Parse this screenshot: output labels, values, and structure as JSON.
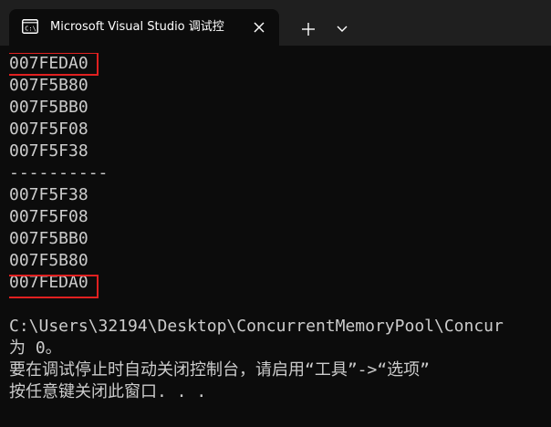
{
  "tab": {
    "title": "Microsoft Visual Studio 调试控",
    "icon": "console-icon",
    "close_icon": "close-icon"
  },
  "toolbar": {
    "new_tab_icon": "plus-icon",
    "dropdown_icon": "chevron-down-icon"
  },
  "console": {
    "lines": [
      "007FEDA0",
      "007F5B80",
      "007F5BB0",
      "007F5F08",
      "007F5F38",
      "----------",
      "007F5F38",
      "007F5F08",
      "007F5BB0",
      "007F5B80",
      "007FEDA0",
      "",
      "C:\\Users\\32194\\Desktop\\ConcurrentMemoryPool\\Concur",
      "为 0。",
      "要在调试停止时自动关闭控制台，请启用“工具”->“选项”",
      "按任意键关闭此窗口. . ."
    ],
    "highlighted_lines": [
      0,
      10
    ],
    "highlight_color": "#e02020",
    "text_color": "#cccccc",
    "background": "#0c0c0c"
  }
}
